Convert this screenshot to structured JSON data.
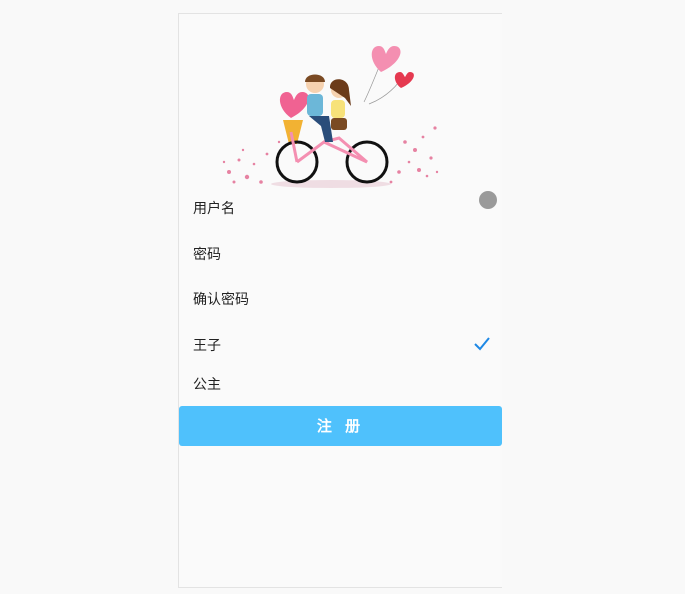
{
  "form": {
    "username_label": "用户名",
    "password_label": "密码",
    "confirm_label": "确认密码"
  },
  "roles": {
    "prince": "王子",
    "princess": "公主",
    "selected": "王子"
  },
  "actions": {
    "register_label": "注 册"
  },
  "colors": {
    "accent": "#4fc1fc",
    "check": "#1e88e5",
    "background": "#f9f9f9"
  }
}
